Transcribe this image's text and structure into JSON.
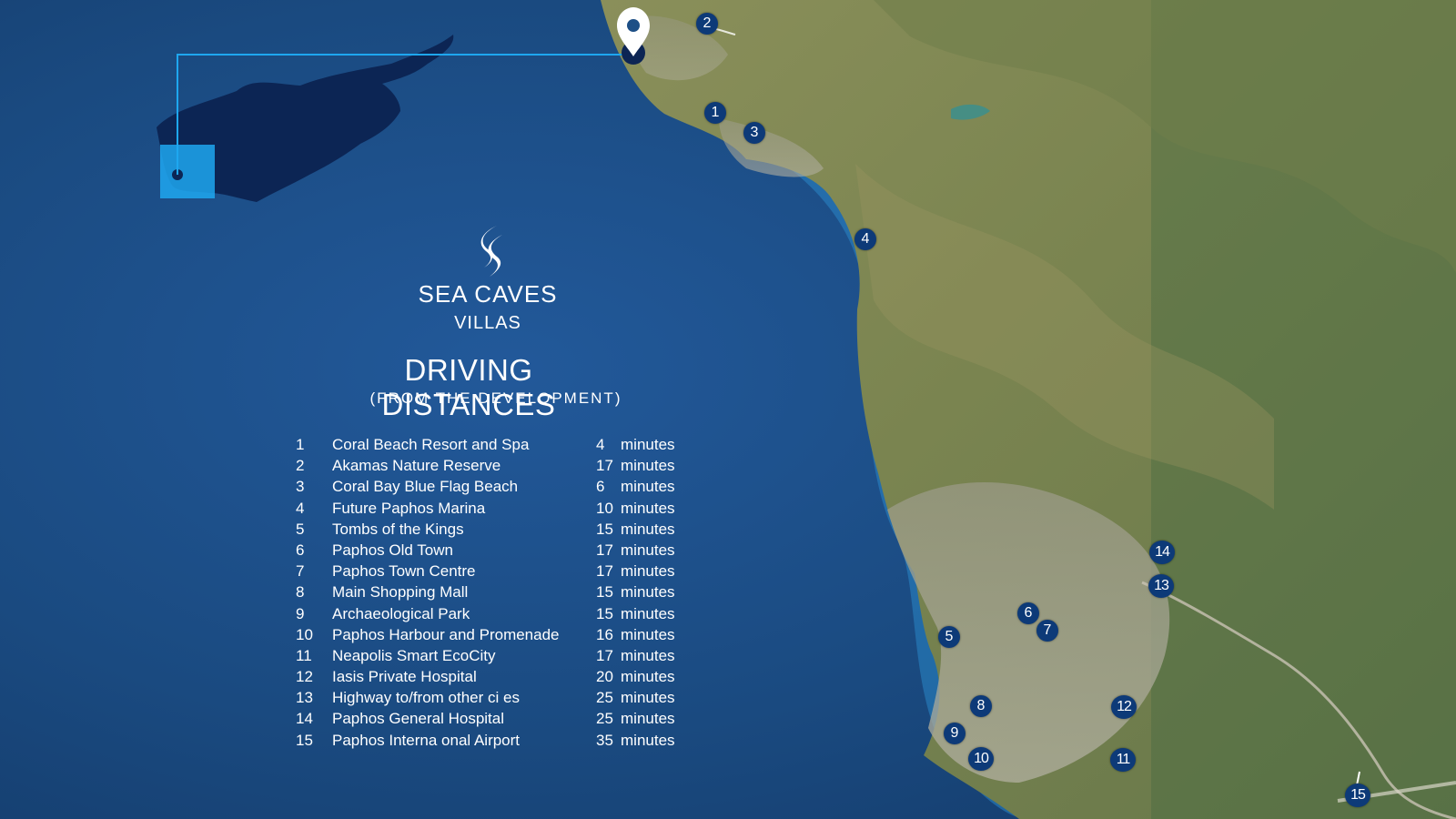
{
  "brand": {
    "logo_icon": "sea-caves-s-logo-icon",
    "name": "SEA  CAVES",
    "subname": "VILLAS"
  },
  "heading": "DRIVING DISTANCES",
  "subheading": "(FROM THE DEVELOPMENT)",
  "distances": [
    {
      "num": "1",
      "place": "Coral Beach Resort and Spa",
      "value": "4",
      "unit": "minutes"
    },
    {
      "num": "2",
      "place": "Akamas Nature Reserve",
      "value": "17",
      "unit": "minutes"
    },
    {
      "num": "3",
      "place": "Coral Bay Blue Flag Beach",
      "value": "6",
      "unit": "minutes"
    },
    {
      "num": "4",
      "place": "Future Paphos Marina",
      "value": "10",
      "unit": "minutes"
    },
    {
      "num": "5",
      "place": "Tombs of the Kings",
      "value": "15",
      "unit": "minutes"
    },
    {
      "num": "6",
      "place": "Paphos Old Town",
      "value": "17",
      "unit": "minutes"
    },
    {
      "num": "7",
      "place": "Paphos Town Centre",
      "value": "17",
      "unit": "minutes"
    },
    {
      "num": "8",
      "place": "Main Shopping Mall",
      "value": "15",
      "unit": "minutes"
    },
    {
      "num": "9",
      "place": "Archaeological Park",
      "value": "15",
      "unit": "minutes"
    },
    {
      "num": "10",
      "place": "Paphos Harbour and Promenade",
      "value": "16",
      "unit": "minutes"
    },
    {
      "num": "11",
      "place": "Neapolis Smart EcoCity",
      "value": "17",
      "unit": "minutes"
    },
    {
      "num": "12",
      "place": "Iasis Private Hospital",
      "value": "20",
      "unit": "minutes"
    },
    {
      "num": "13",
      "place": "Highway to/from other ci es",
      "value": "25",
      "unit": "minutes"
    },
    {
      "num": "14",
      "place": "Paphos General Hospital",
      "value": "25",
      "unit": "minutes"
    },
    {
      "num": "15",
      "place": "Paphos Interna onal Airport",
      "value": "35",
      "unit": "minutes"
    }
  ],
  "markers": [
    "1",
    "2",
    "3",
    "4",
    "5",
    "6",
    "7",
    "8",
    "9",
    "10",
    "11",
    "12",
    "13",
    "14",
    "15"
  ],
  "location_pin_icon": "map-pin-icon",
  "colors": {
    "sea": "#1d4f86",
    "land": "#7d8a55",
    "cyprus_silhouette": "#0c2554",
    "highlight": "#1ea7f0",
    "marker": "#0d3a78",
    "text": "#ffffff"
  }
}
